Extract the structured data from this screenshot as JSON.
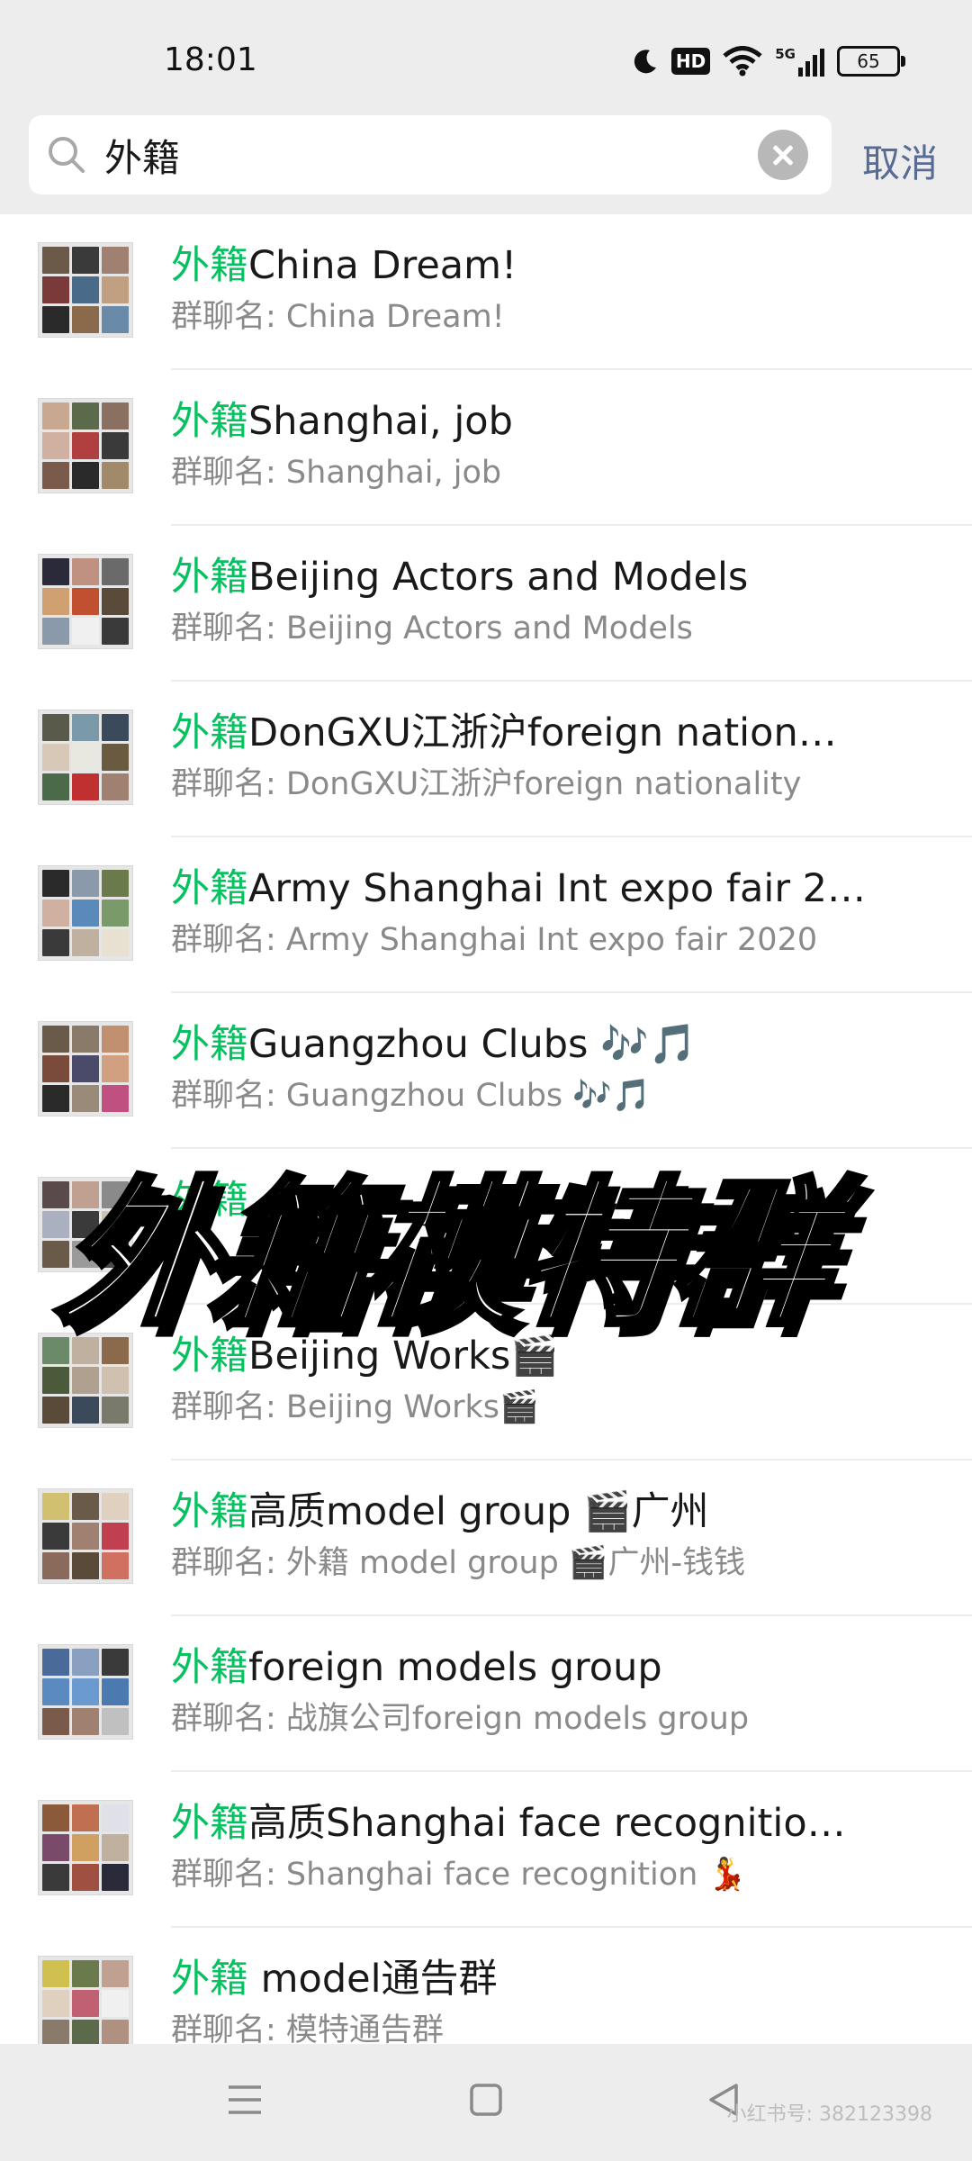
{
  "status_bar": {
    "time": "18:01",
    "hd_label": "HD",
    "network_label": "5G",
    "battery_level": "65"
  },
  "search": {
    "query": "外籍",
    "cancel_label": "取消"
  },
  "keyword": "外籍",
  "overlay_text": "外籍模特群",
  "results": [
    {
      "title_rest": "China Dream!",
      "subtitle": "群聊名: China Dream!"
    },
    {
      "title_rest": "Shanghai, job",
      "subtitle": "群聊名: Shanghai, job"
    },
    {
      "title_rest": "Beijing Actors and Models",
      "subtitle": "群聊名: Beijing Actors and Models"
    },
    {
      "title_rest": "DonGXU江浙沪foreign nation…",
      "subtitle": "群聊名: DonGXU江浙沪foreign nationality"
    },
    {
      "title_rest": "Army Shanghai Int expo fair 2…",
      "subtitle": "群聊名: Army Shanghai Int expo fair 2020"
    },
    {
      "title_rest": "Guangzhou Clubs 🎶🎵",
      "subtitle": "群聊名: Guangzhou Clubs 🎶🎵"
    },
    {
      "title_rest": "",
      "subtitle": ""
    },
    {
      "title_rest": "Beijing Works🎬",
      "subtitle": "群聊名: Beijing Works🎬"
    },
    {
      "title_rest": "高质model group 🎬广州",
      "subtitle": "群聊名: 外籍 model group 🎬广州-钱钱"
    },
    {
      "title_rest": "foreign models group",
      "subtitle": "群聊名: 战旗公司foreign models group"
    },
    {
      "title_rest": "高质Shanghai face recognitio…",
      "subtitle": "群聊名: Shanghai face recognition 💃"
    },
    {
      "title_rest": " model通告群",
      "subtitle": "群聊名: 模特通告群"
    }
  ],
  "watermark": "小红书号: 382123398",
  "colors": {
    "keyword": "#07c160",
    "cancel": "#576b95",
    "header_bg": "#ededed",
    "subtitle": "#8a8a8a"
  }
}
